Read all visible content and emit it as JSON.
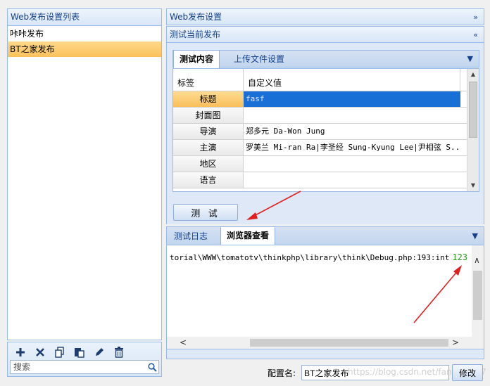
{
  "left_panel": {
    "title": "Web发布设置列表",
    "items": [
      {
        "label": "咔咔发布",
        "selected": false
      },
      {
        "label": "BT之家发布",
        "selected": true
      }
    ],
    "toolbar": {
      "icons": [
        "add-icon",
        "delete-icon",
        "copy-icon",
        "paste-icon",
        "edit-icon",
        "trash-icon"
      ],
      "search_placeholder": "搜索"
    }
  },
  "panels": {
    "web_settings_title": "Web发布设置",
    "test_current_title": "测试当前发布"
  },
  "test_tabs": {
    "items": [
      "测试内容",
      "上传文件设置"
    ],
    "active": 0
  },
  "grid": {
    "columns": [
      "标签",
      "自定义值"
    ],
    "rows": [
      {
        "label": "标题",
        "value": "fasf",
        "selected": true
      },
      {
        "label": "封面图",
        "value": ""
      },
      {
        "label": "导演",
        "value": "郑多元 Da-Won Jung"
      },
      {
        "label": "主演",
        "value": "罗美兰 Mi-ran Ra|李圣经 Sung-Kyung Lee|尹相弦 S..."
      },
      {
        "label": "地区",
        "value": ""
      },
      {
        "label": "语言",
        "value": ""
      }
    ]
  },
  "test_button": {
    "label": "测 试"
  },
  "bottom_tabs": {
    "items": [
      "测试日志",
      "浏览器查看"
    ],
    "active": 1
  },
  "browser_view": {
    "text": "torial\\WWW\\tomatotv\\thinkphp\\library\\think\\Debug.php:193:int",
    "number": "123"
  },
  "config": {
    "label": "配置名:",
    "value": "BT之家发布",
    "modify_label": "修改"
  },
  "watermark": "https://blog.csdn.net/fangbing07",
  "colors": {
    "panel_header_text": "#15428b",
    "selection_blue": "#1a6fd6",
    "selection_orange": "#fbc15a",
    "annotation_red": "#e02020",
    "number_green": "#2a9a1e"
  }
}
